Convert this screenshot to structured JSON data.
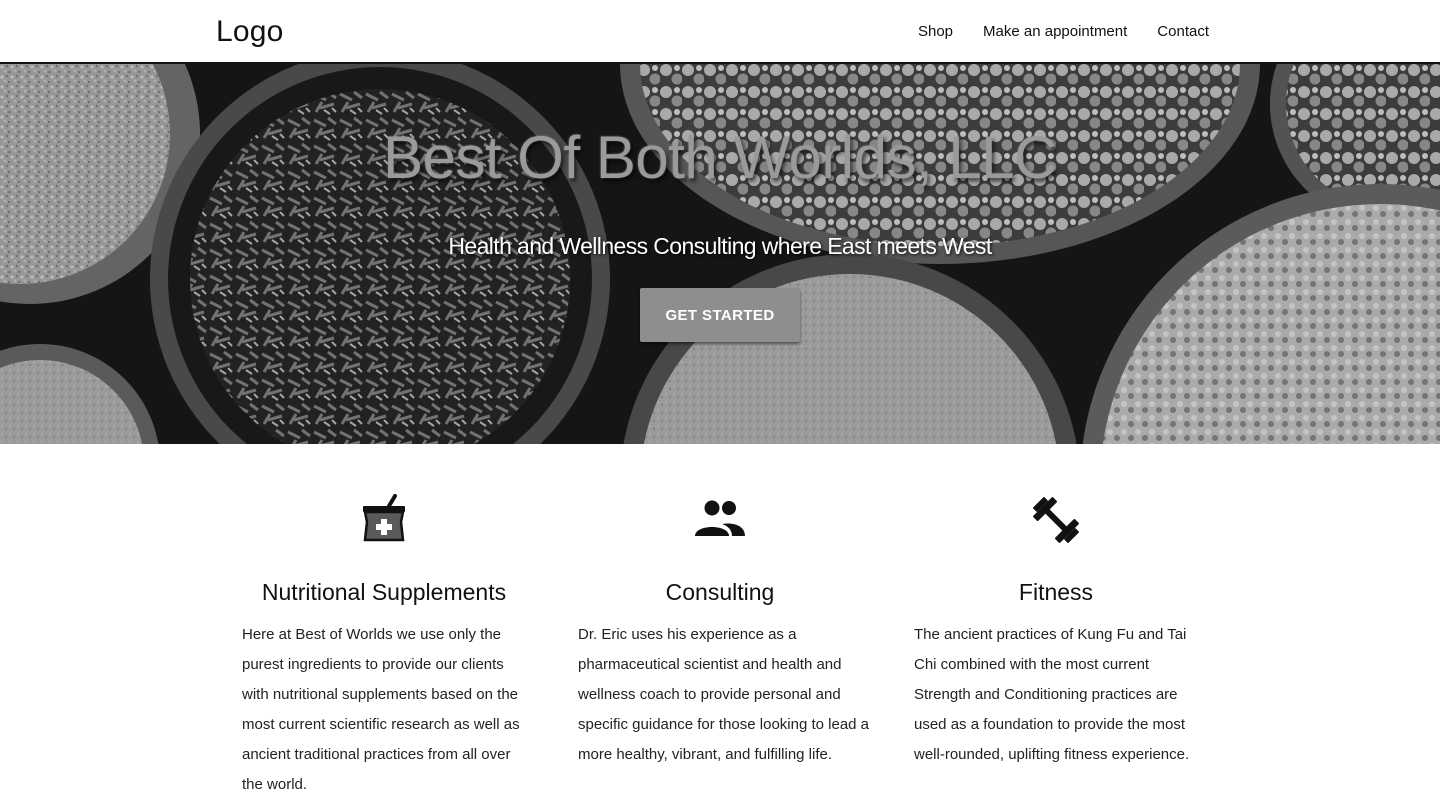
{
  "nav": {
    "logo": "Logo",
    "links": [
      "Shop",
      "Make an appointment",
      "Contact"
    ]
  },
  "hero": {
    "title": "Best Of Both Worlds, LLC",
    "subtitle": "Health and Wellness Consulting where East meets West",
    "cta": "GET STARTED"
  },
  "features": [
    {
      "icon": "mortar-pestle-icon",
      "title": "Nutritional Supplements",
      "text": "Here at Best of Worlds we use only the purest ingredients to provide our clients with nutritional supplements based on the most current scientific research as well as ancient traditional practices from all over the world."
    },
    {
      "icon": "people-icon",
      "title": "Consulting",
      "text": "Dr. Eric uses his experience as a pharmaceutical scientist and health and wellness coach to provide personal and specific guidance for those looking to lead a more healthy, vibrant, and fulfilling life."
    },
    {
      "icon": "dumbbell-icon",
      "title": "Fitness",
      "text": "The ancient practices of Kung Fu and Tai Chi combined with the most current Strength and Conditioning practices are used as a foundation to provide the most well-rounded, uplifting fitness experience."
    }
  ],
  "colors": {
    "accent": "#8e8e8e",
    "text": "#111111",
    "background": "#ffffff"
  }
}
